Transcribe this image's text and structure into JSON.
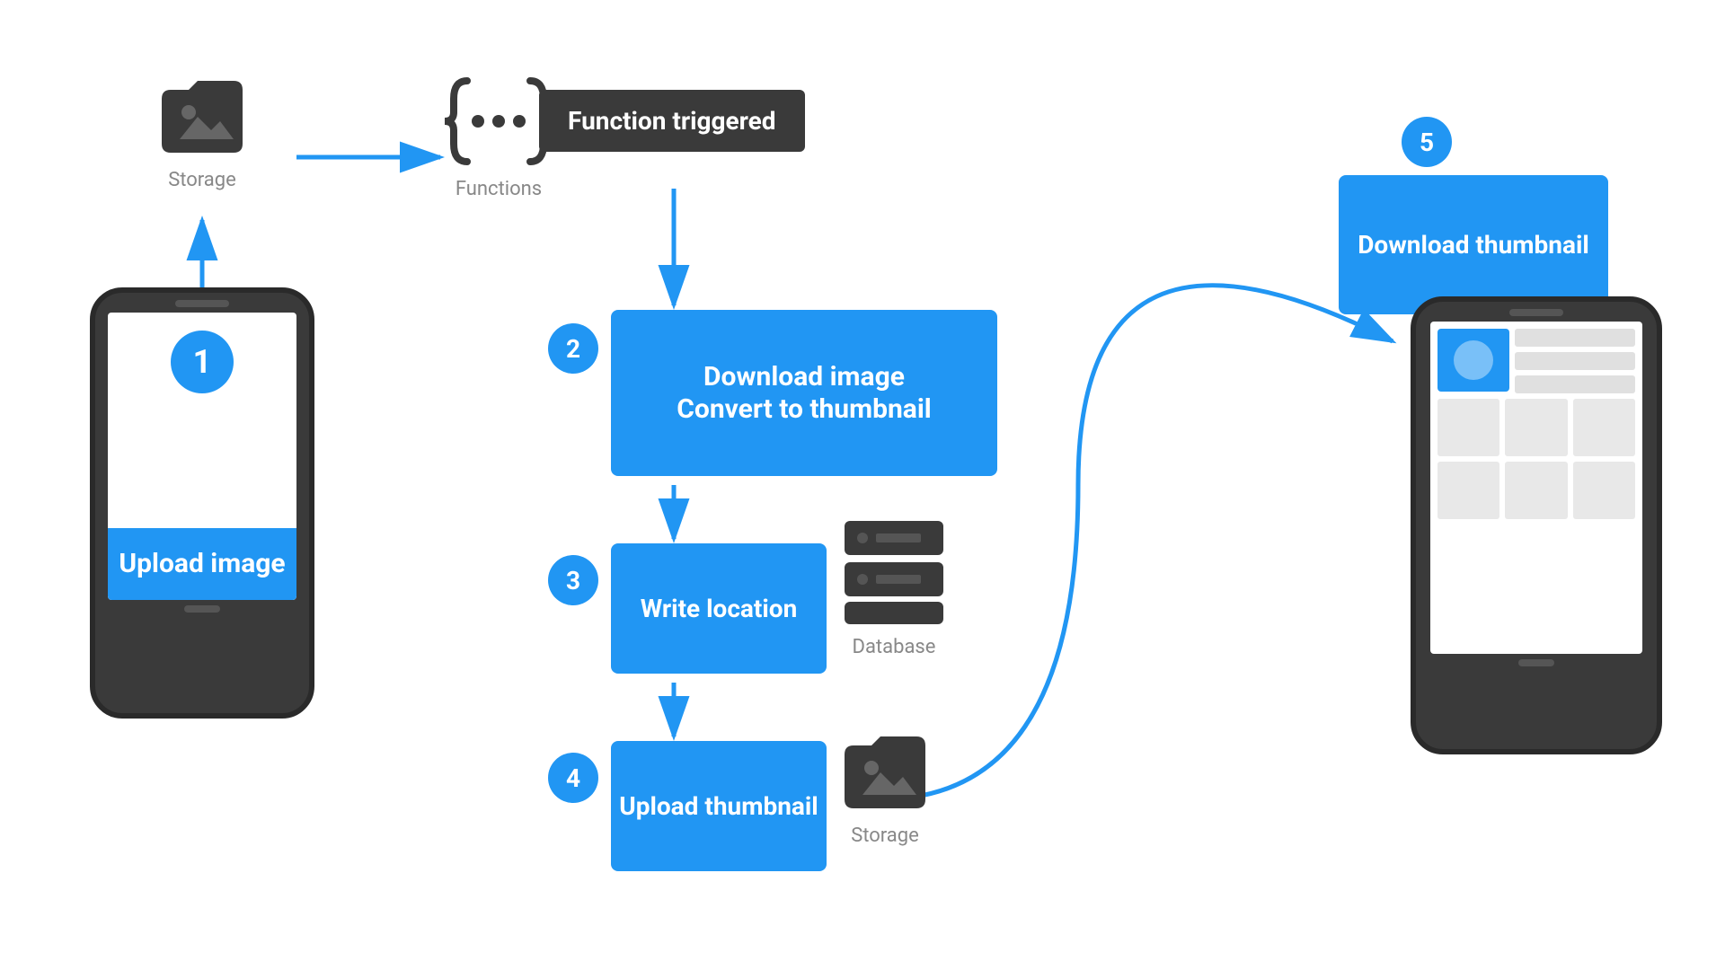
{
  "colors": {
    "blue": "#2196F3",
    "dark": "#3a3a3a",
    "gray": "#888888",
    "white": "#ffffff",
    "arrow": "#2196F3"
  },
  "steps": [
    {
      "number": "1",
      "label": "Upload image"
    },
    {
      "number": "2",
      "label": "Download image\nConvert to thumbnail"
    },
    {
      "number": "3",
      "label": "Write location"
    },
    {
      "number": "4",
      "label": "Upload thumbnail"
    },
    {
      "number": "5",
      "label": "Download thumbnail"
    }
  ],
  "labels": {
    "storage_top": "Storage",
    "storage_bottom": "Storage",
    "functions": "Functions",
    "database": "Database",
    "triggered": "Function triggered"
  }
}
